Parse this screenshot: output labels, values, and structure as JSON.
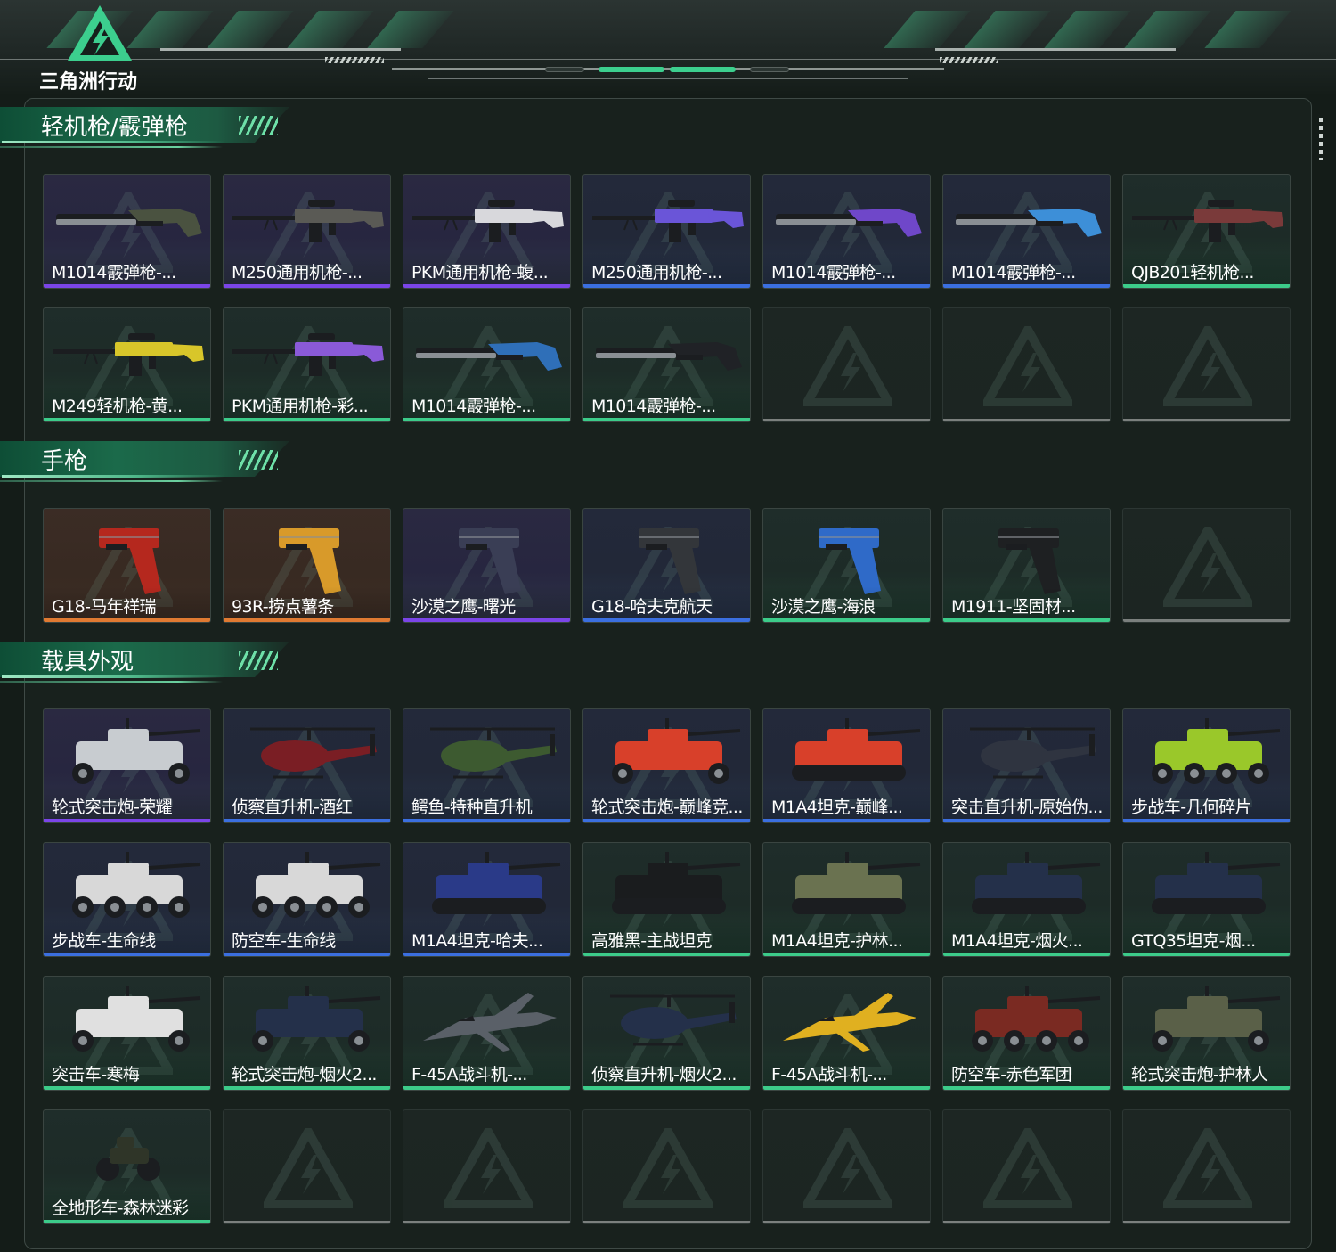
{
  "game": {
    "title": "三角洲行动"
  },
  "colors": {
    "accent": "#3ccf8e",
    "rarity_purple": "#7b45e8",
    "rarity_blue": "#3b6fe0",
    "rarity_green": "#3ccc8a",
    "rarity_orange": "#e07a32",
    "empty": "#7b807e"
  },
  "sections": [
    {
      "title": "轻机枪/霰弹枪",
      "items": [
        {
          "label": "M1014霰弹枪-...",
          "rarity": "purple",
          "icon": "shotgun-icon",
          "color": "#4a5240"
        },
        {
          "label": "M250通用机枪-...",
          "rarity": "purple",
          "icon": "machine-gun-icon",
          "color": "#5a5a55"
        },
        {
          "label": "PKM通用机枪-蝮...",
          "rarity": "purple",
          "icon": "machine-gun-icon",
          "color": "#d8d8dc"
        },
        {
          "label": "M250通用机枪-...",
          "rarity": "blue",
          "icon": "machine-gun-icon",
          "color": "#6a55d8"
        },
        {
          "label": "M1014霰弹枪-...",
          "rarity": "blue",
          "icon": "shotgun-icon",
          "color": "#6f47c9"
        },
        {
          "label": "M1014霰弹枪-...",
          "rarity": "blue",
          "icon": "shotgun-icon",
          "color": "#3d8fd8"
        },
        {
          "label": "QJB201轻机枪...",
          "rarity": "green",
          "icon": "light-machine-gun-icon",
          "color": "#7a3a3a"
        },
        {
          "label": "M249轻机枪-黄...",
          "rarity": "green",
          "icon": "light-machine-gun-icon",
          "color": "#d8c62a"
        },
        {
          "label": "PKM通用机枪-彩...",
          "rarity": "green",
          "icon": "machine-gun-icon",
          "color": "#8a5ad8"
        },
        {
          "label": "M1014霰弹枪-...",
          "rarity": "green",
          "icon": "shotgun-icon",
          "color": "#2f6fb8"
        },
        {
          "label": "M1014霰弹枪-...",
          "rarity": "green",
          "icon": "shotgun-icon",
          "color": "#202226"
        },
        {
          "label": "",
          "rarity": "empty",
          "icon": "empty-slot-icon"
        },
        {
          "label": "",
          "rarity": "empty",
          "icon": "empty-slot-icon"
        },
        {
          "label": "",
          "rarity": "empty",
          "icon": "empty-slot-icon"
        }
      ]
    },
    {
      "title": "手枪",
      "items": [
        {
          "label": "G18-马年祥瑞",
          "rarity": "orange",
          "icon": "pistol-icon",
          "color": "#b5281e"
        },
        {
          "label": "93R-捞点薯条",
          "rarity": "orange",
          "icon": "pistol-icon",
          "color": "#d89a2a"
        },
        {
          "label": "沙漠之鹰-曙光",
          "rarity": "purple",
          "icon": "desert-eagle-icon",
          "color": "#3a3e55"
        },
        {
          "label": "G18-哈夫克航天",
          "rarity": "blue",
          "icon": "pistol-icon",
          "color": "#33363a"
        },
        {
          "label": "沙漠之鹰-海浪",
          "rarity": "green",
          "icon": "desert-eagle-icon",
          "color": "#2f6ac8"
        },
        {
          "label": "M1911-坚固材...",
          "rarity": "green",
          "icon": "pistol-icon",
          "color": "#1e2022"
        },
        {
          "label": "",
          "rarity": "empty",
          "icon": "empty-slot-icon"
        }
      ]
    },
    {
      "title": "载具外观",
      "items": [
        {
          "label": "轮式突击炮-荣耀",
          "rarity": "purple",
          "icon": "wheeled-vehicle-icon",
          "color": "#c8ccd0"
        },
        {
          "label": "侦察直升机-酒红",
          "rarity": "blue",
          "icon": "helicopter-icon",
          "color": "#7a1e24"
        },
        {
          "label": "鳄鱼-特种直升机",
          "rarity": "blue",
          "icon": "attack-helicopter-icon",
          "color": "#3d5a30"
        },
        {
          "label": "轮式突击炮-巅峰竞...",
          "rarity": "blue",
          "icon": "wheeled-vehicle-icon",
          "color": "#d8402a"
        },
        {
          "label": "M1A4坦克-巅峰...",
          "rarity": "blue",
          "icon": "tank-icon",
          "color": "#d8402a"
        },
        {
          "label": "突击直升机-原始伪...",
          "rarity": "blue",
          "icon": "attack-helicopter-icon",
          "color": "#2f3440"
        },
        {
          "label": "步战车-几何碎片",
          "rarity": "blue",
          "icon": "ifv-icon",
          "color": "#9ac82a"
        },
        {
          "label": "步战车-生命线",
          "rarity": "blue",
          "icon": "ifv-icon",
          "color": "#d8d8d8"
        },
        {
          "label": "防空车-生命线",
          "rarity": "blue",
          "icon": "ifv-icon",
          "color": "#d8d8d8"
        },
        {
          "label": "M1A4坦克-哈夫...",
          "rarity": "blue",
          "icon": "tank-icon",
          "color": "#2a3a88"
        },
        {
          "label": "高雅黑-主战坦克",
          "rarity": "green",
          "icon": "tank-icon",
          "color": "#1a1c1e"
        },
        {
          "label": "M1A4坦克-护林...",
          "rarity": "green",
          "icon": "tank-icon",
          "color": "#6a7250"
        },
        {
          "label": "M1A4坦克-烟火...",
          "rarity": "green",
          "icon": "tank-icon",
          "color": "#24304a"
        },
        {
          "label": "GTQ35坦克-烟...",
          "rarity": "green",
          "icon": "tank-icon",
          "color": "#24304a"
        },
        {
          "label": "突击车-寒梅",
          "rarity": "green",
          "icon": "assault-vehicle-icon",
          "color": "#e0e0e0"
        },
        {
          "label": "轮式突击炮-烟火2...",
          "rarity": "green",
          "icon": "wheeled-vehicle-icon",
          "color": "#24304a"
        },
        {
          "label": "F-45A战斗机-...",
          "rarity": "green",
          "icon": "fighter-jet-icon",
          "color": "#5a6068"
        },
        {
          "label": "侦察直升机-烟火2...",
          "rarity": "green",
          "icon": "helicopter-icon",
          "color": "#24304a"
        },
        {
          "label": "F-45A战斗机-...",
          "rarity": "green",
          "icon": "fighter-jet-icon",
          "color": "#e0b020"
        },
        {
          "label": "防空车-赤色军团",
          "rarity": "green",
          "icon": "ifv-icon",
          "color": "#7a2a22"
        },
        {
          "label": "轮式突击炮-护林人",
          "rarity": "green",
          "icon": "wheeled-vehicle-icon",
          "color": "#5a6048"
        },
        {
          "label": "全地形车-森林迷彩",
          "rarity": "green",
          "icon": "atv-icon",
          "color": "#2f3528"
        },
        {
          "label": "",
          "rarity": "empty",
          "icon": "empty-slot-icon"
        },
        {
          "label": "",
          "rarity": "empty",
          "icon": "empty-slot-icon"
        },
        {
          "label": "",
          "rarity": "empty",
          "icon": "empty-slot-icon"
        },
        {
          "label": "",
          "rarity": "empty",
          "icon": "empty-slot-icon"
        },
        {
          "label": "",
          "rarity": "empty",
          "icon": "empty-slot-icon"
        },
        {
          "label": "",
          "rarity": "empty",
          "icon": "empty-slot-icon"
        }
      ]
    }
  ]
}
